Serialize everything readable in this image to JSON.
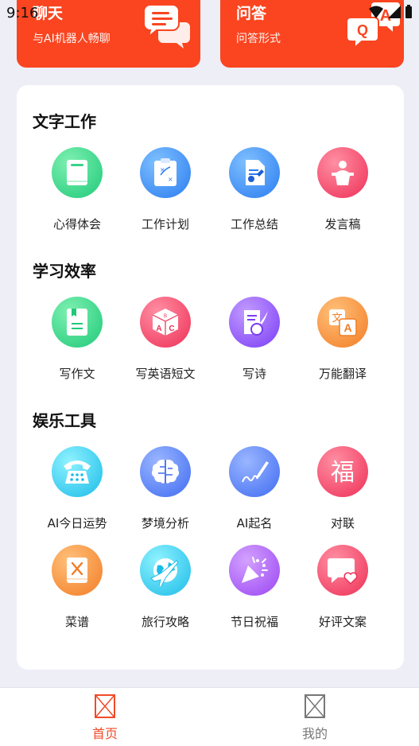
{
  "status_bar": {
    "time": "9:16"
  },
  "top_cards": [
    {
      "title": "聊天",
      "subtitle": "与AI机器人畅聊"
    },
    {
      "title": "问答",
      "subtitle": "问答形式",
      "icon_letters": [
        "Q",
        "A"
      ]
    }
  ],
  "sections": [
    {
      "title": "文字工作",
      "items": [
        {
          "label": "心得体会",
          "icon": "book-icon"
        },
        {
          "label": "工作计划",
          "icon": "clipboard-plan-icon"
        },
        {
          "label": "工作总结",
          "icon": "document-pen-icon"
        },
        {
          "label": "发言稿",
          "icon": "podium-speaker-icon"
        }
      ]
    },
    {
      "title": "学习效率",
      "items": [
        {
          "label": "写作文",
          "icon": "notebook-icon"
        },
        {
          "label": "写英语短文",
          "icon": "abc-cube-icon",
          "icon_letters": [
            "A",
            "B",
            "C"
          ]
        },
        {
          "label": "写诗",
          "icon": "scroll-quill-icon"
        },
        {
          "label": "万能翻译",
          "icon": "translate-icon",
          "icon_letters": [
            "文",
            "A"
          ]
        }
      ]
    },
    {
      "title": "娱乐工具",
      "items": [
        {
          "label": "AI今日运势",
          "icon": "telephone-icon"
        },
        {
          "label": "梦境分析",
          "icon": "brain-icon"
        },
        {
          "label": "AI起名",
          "icon": "pen-signature-icon"
        },
        {
          "label": "对联",
          "icon": "fu-character-icon",
          "icon_letters": [
            "福"
          ]
        },
        {
          "label": "菜谱",
          "icon": "recipe-book-icon"
        },
        {
          "label": "旅行攻略",
          "icon": "globe-plane-icon"
        },
        {
          "label": "节日祝福",
          "icon": "party-popper-icon"
        },
        {
          "label": "好评文案",
          "icon": "heart-message-icon"
        }
      ]
    }
  ],
  "bottom_nav": [
    {
      "label": "首页",
      "active": true
    },
    {
      "label": "我的",
      "active": false
    }
  ],
  "colors": {
    "accent": "#fa4520",
    "active_tab": "#f04b2a",
    "inactive_tab": "#777777",
    "background": "#eeeef7"
  }
}
